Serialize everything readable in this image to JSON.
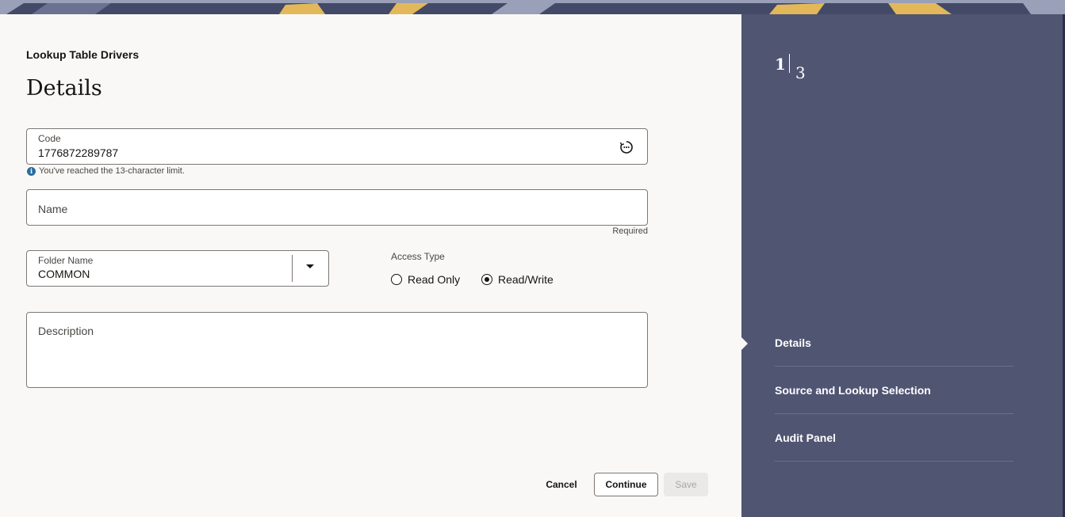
{
  "breadcrumb": "Lookup Table Drivers",
  "page_title": "Details",
  "code_field": {
    "label": "Code",
    "value": "1776872289787",
    "icon": "refresh-chat-icon"
  },
  "code_hint": "You've reached the 13-character limit.",
  "name_field": {
    "placeholder": "Name",
    "required_text": "Required"
  },
  "folder_field": {
    "label": "Folder Name",
    "value": "COMMON"
  },
  "access_type": {
    "label": "Access Type",
    "options": [
      {
        "label": "Read Only",
        "selected": false
      },
      {
        "label": "Read/Write",
        "selected": true
      }
    ]
  },
  "description_field": {
    "placeholder": "Description"
  },
  "actions": {
    "cancel": "Cancel",
    "continue": "Continue",
    "save": "Save"
  },
  "train": {
    "current": "1",
    "total": "3",
    "steps": [
      "Details",
      "Source and Lookup Selection",
      "Audit Panel"
    ]
  },
  "colors": {
    "side_panel": "#505572",
    "page_bg": "#f9f8f6",
    "info": "#2b6c9e"
  }
}
